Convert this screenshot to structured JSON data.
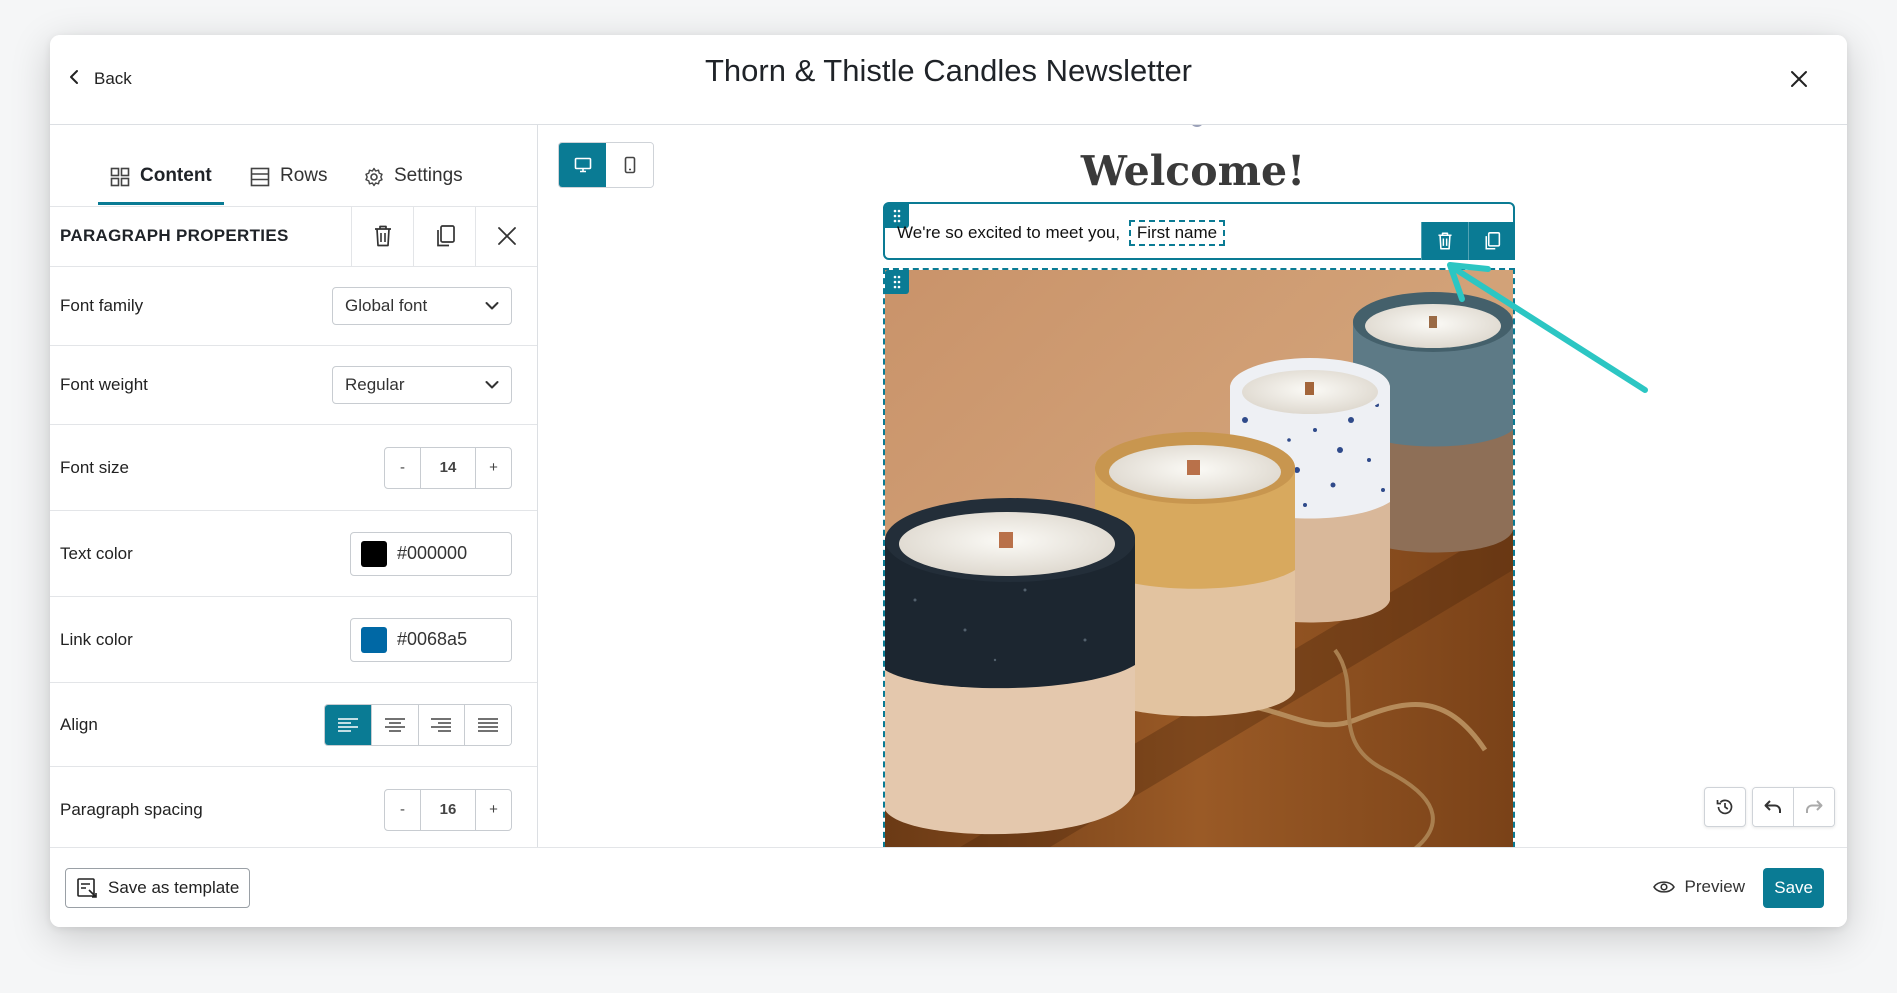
{
  "header": {
    "back_label": "Back",
    "title": "Thorn & Thistle Candles Newsletter"
  },
  "tabs": [
    {
      "label": "Content",
      "icon": "grid-icon",
      "active": true
    },
    {
      "label": "Rows",
      "icon": "rows-icon",
      "active": false
    },
    {
      "label": "Settings",
      "icon": "gear-icon",
      "active": false
    }
  ],
  "properties": {
    "title": "PARAGRAPH PROPERTIES",
    "font_family": {
      "label": "Font family",
      "value": "Global font"
    },
    "font_weight": {
      "label": "Font weight",
      "value": "Regular"
    },
    "font_size": {
      "label": "Font size",
      "value": "14",
      "minus": "-",
      "plus": "+"
    },
    "text_color": {
      "label": "Text color",
      "value": "#000000",
      "swatch": "#000000"
    },
    "link_color": {
      "label": "Link color",
      "value": "#0068a5",
      "swatch": "#0068a5"
    },
    "align": {
      "label": "Align",
      "selected": "left"
    },
    "paragraph_spacing": {
      "label": "Paragraph spacing",
      "value": "16",
      "minus": "-",
      "plus": "+"
    }
  },
  "canvas": {
    "heading": "Welcome!",
    "paragraph_text": "We're so excited to meet you,",
    "merge_tag": "First name"
  },
  "footer": {
    "save_template_label": "Save as template",
    "preview_label": "Preview",
    "save_label": "Save"
  },
  "colors": {
    "accent": "#0a7b94",
    "annotation_arrow": "#2cc6c3"
  }
}
